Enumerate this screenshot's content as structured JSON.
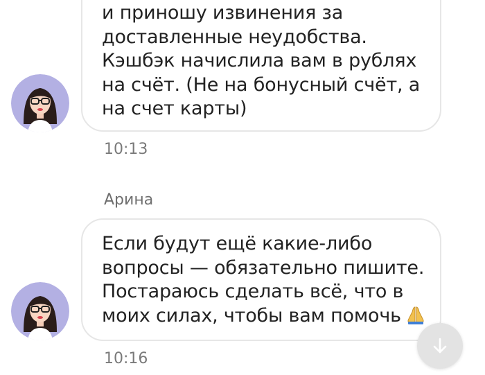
{
  "messages": [
    {
      "lines": [
        "и приношу извинения за",
        "доставленные неудобства.",
        "Кэшбэк начислила вам в рублях",
        "на счёт. (Не на бонусный счёт, а",
        "на счет карты)"
      ],
      "time": "10:13"
    },
    {
      "sender": "Арина",
      "lines": [
        "Если будут ещё какие-либо",
        "вопросы — обязательно пишите.",
        "Постараюсь сделать всё, что в",
        "моих силах, чтобы вам помочь"
      ],
      "emoji": "folded-hands-icon",
      "time": "10:16"
    }
  ],
  "avatar": {
    "icon": "operator-avatar-icon",
    "background": "#b3b0e3"
  },
  "scroll_button": {
    "icon": "arrow-down-icon"
  }
}
